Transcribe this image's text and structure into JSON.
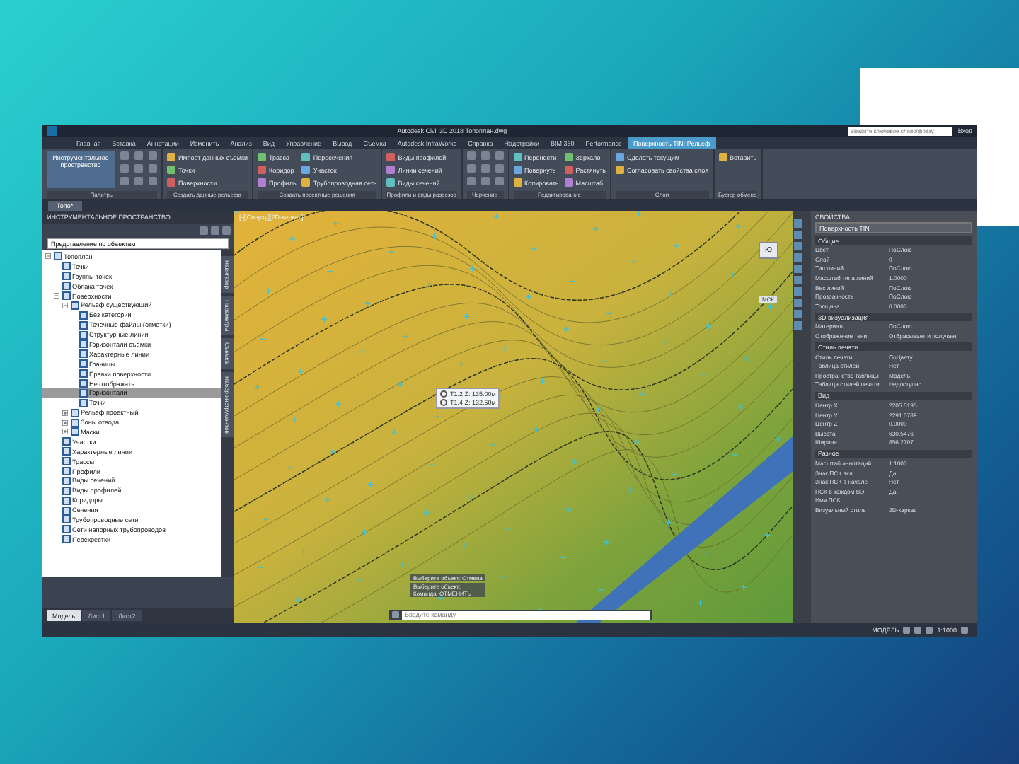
{
  "window": {
    "title": "Autodesk Civil 3D 2018   Топоплан.dwg",
    "search_placeholder": "Введите ключевое слово/фразу",
    "user": "Вход"
  },
  "ribbon": {
    "tabs": [
      {
        "label": "Главная",
        "selected": false
      },
      {
        "label": "Вставка",
        "selected": false
      },
      {
        "label": "Аннотации",
        "selected": false
      },
      {
        "label": "Изменить",
        "selected": false
      },
      {
        "label": "Анализ",
        "selected": false
      },
      {
        "label": "Вид",
        "selected": false
      },
      {
        "label": "Управление",
        "selected": false
      },
      {
        "label": "Вывод",
        "selected": false
      },
      {
        "label": "Съемка",
        "selected": false
      },
      {
        "label": "Autodesk InfraWorks",
        "selected": false
      },
      {
        "label": "Справка",
        "selected": false
      },
      {
        "label": "Надстройки",
        "selected": false
      },
      {
        "label": "BIM 360",
        "selected": false
      },
      {
        "label": "Performance",
        "selected": false
      },
      {
        "label": "Поверхность TIN: Рельеф",
        "selected": true
      }
    ],
    "panels": [
      {
        "title": "Палитры",
        "big": "Инструментальное пространство"
      },
      {
        "title": "Создать данные рельефа",
        "buttons": [
          "Импорт данных съемки",
          "Точки",
          "Поверхности"
        ]
      },
      {
        "title": "Создать проектные решения",
        "buttons": [
          "Трасса",
          "Коридор",
          "Профиль",
          "Пересечения",
          "Участок",
          "Трубопроводная сеть"
        ]
      },
      {
        "title": "Профили и виды разрезов",
        "buttons": [
          "Виды профилей",
          "Линии сечений",
          "Виды сечений"
        ]
      },
      {
        "title": "Черчение"
      },
      {
        "title": "Редактирование",
        "buttons": [
          "Перенести",
          "Повернуть",
          "Копировать",
          "Зеркало",
          "Растянуть",
          "Масштаб"
        ]
      },
      {
        "title": "Слои",
        "buttons": [
          "Сделать текущим",
          "Согласовать свойства слоя"
        ]
      },
      {
        "title": "Буфер обмена",
        "buttons": [
          "Вставить"
        ]
      }
    ]
  },
  "file_tabs": [
    {
      "label": "Топо*",
      "selected": true
    }
  ],
  "toolspace": {
    "title": "ИНСТРУМЕНТАЛЬНОЕ ПРОСТРАНСТВО",
    "view": "Представление по объектам",
    "tree": [
      {
        "label": "Топоплан",
        "expanded": true,
        "selected": false,
        "children": [
          {
            "label": "Точки",
            "selected": false
          },
          {
            "label": "Группы точек",
            "selected": false
          },
          {
            "label": "Облака точек",
            "selected": false
          },
          {
            "label": "Поверхности",
            "expanded": true,
            "selected": false,
            "children": [
              {
                "label": "Рельеф существующий",
                "expanded": true,
                "selected": false,
                "children": [
                  {
                    "label": "Без категории",
                    "selected": false
                  },
                  {
                    "label": "Точечные файлы (отметки)",
                    "selected": false
                  },
                  {
                    "label": "Структурные линии",
                    "selected": false
                  },
                  {
                    "label": "Горизонтали съемки",
                    "selected": false
                  },
                  {
                    "label": "Характерные линии",
                    "selected": false
                  },
                  {
                    "label": "Границы",
                    "selected": false
                  },
                  {
                    "label": "Правки поверхности",
                    "selected": false
                  },
                  {
                    "label": "Не отображать",
                    "selected": false
                  },
                  {
                    "label": "Горизонтали",
                    "selected": true
                  },
                  {
                    "label": "Точки",
                    "selected": false
                  }
                ]
              },
              {
                "label": "Рельеф проектный",
                "expanded": false,
                "selected": false
              },
              {
                "label": "Зоны отвода",
                "expanded": false,
                "selected": false
              },
              {
                "label": "Маски",
                "expanded": false,
                "selected": false
              }
            ]
          },
          {
            "label": "Участки",
            "selected": false
          },
          {
            "label": "Характерные линии",
            "selected": false
          },
          {
            "label": "Трассы",
            "selected": false
          },
          {
            "label": "Профили",
            "selected": false
          },
          {
            "label": "Виды сечений",
            "selected": false
          },
          {
            "label": "Виды профилей",
            "selected": false
          },
          {
            "label": "Коридоры",
            "selected": false
          },
          {
            "label": "Сечения",
            "selected": false
          },
          {
            "label": "Трубопроводные сети",
            "selected": false
          },
          {
            "label": "Сети напорных трубопроводов",
            "selected": false
          },
          {
            "label": "Перекрестки",
            "selected": false
          }
        ]
      }
    ],
    "side_tabs": [
      "Навигатор",
      "Параметры",
      "Съемка",
      "Набор инструментов"
    ],
    "bottom_tabs": [
      {
        "label": "Модель",
        "selected": true
      },
      {
        "label": "Лист1",
        "selected": false
      },
      {
        "label": "Лист2",
        "selected": false
      }
    ]
  },
  "viewport": {
    "label": "[-][Сверху][2D-каркас]",
    "viewcube": "Ю",
    "wcs": "МСК",
    "tooltip": [
      "Т1.2  Z: 135.00м",
      "Т1.4  Z: 132.50м"
    ],
    "command_history": [
      "Выберите объект: Отмена",
      "Выберите объект:",
      "Команда: ОТМЕНИТЬ"
    ],
    "command_placeholder": "Введите команду"
  },
  "properties": {
    "title": "СВОЙСТВА",
    "object": "Поверхность TIN",
    "sections": [
      {
        "title": "Общие",
        "rows": [
          {
            "name": "Цвет",
            "value": "ПоСлою"
          },
          {
            "name": "Слой",
            "value": "0"
          },
          {
            "name": "Тип линий",
            "value": "ПоСлою"
          },
          {
            "name": "Масштаб типа линий",
            "value": "1.0000"
          },
          {
            "name": "Вес линий",
            "value": "ПоСлою"
          },
          {
            "name": "Прозрачность",
            "value": "ПоСлою"
          },
          {
            "name": "Толщина",
            "value": "0.0000"
          }
        ]
      },
      {
        "title": "3D визуализация",
        "rows": [
          {
            "name": "Материал",
            "value": "ПоСлою"
          },
          {
            "name": "Отображение тени",
            "value": "Отбрасывает и получает"
          }
        ]
      },
      {
        "title": "Стиль печати",
        "rows": [
          {
            "name": "Стиль печати",
            "value": "ПоЦвету"
          },
          {
            "name": "Таблица стилей",
            "value": "Нет"
          },
          {
            "name": "Пространство таблицы",
            "value": "Модель"
          },
          {
            "name": "Таблица стилей печати",
            "value": "Недоступно"
          }
        ]
      },
      {
        "title": "Вид",
        "rows": [
          {
            "name": "Центр X",
            "value": "2205.5195"
          },
          {
            "name": "Центр Y",
            "value": "2291.0789"
          },
          {
            "name": "Центр Z",
            "value": "0.0000"
          },
          {
            "name": "Высота",
            "value": "630.5476"
          },
          {
            "name": "Ширина",
            "value": "856.2707"
          }
        ]
      },
      {
        "title": "Разное",
        "rows": [
          {
            "name": "Масштаб аннотаций",
            "value": "1:1000"
          },
          {
            "name": "Знак ПСК вкл",
            "value": "Да"
          },
          {
            "name": "Знак ПСК в начале",
            "value": "Нет"
          },
          {
            "name": "ПСК в каждом ВЭ",
            "value": "Да"
          },
          {
            "name": "Имя ПСК"
          },
          {
            "name": "Визуальный стиль",
            "value": "2D-каркас"
          }
        ]
      }
    ]
  },
  "status_bar": {
    "model": "МОДЕЛЬ",
    "scale": "1:1000"
  }
}
